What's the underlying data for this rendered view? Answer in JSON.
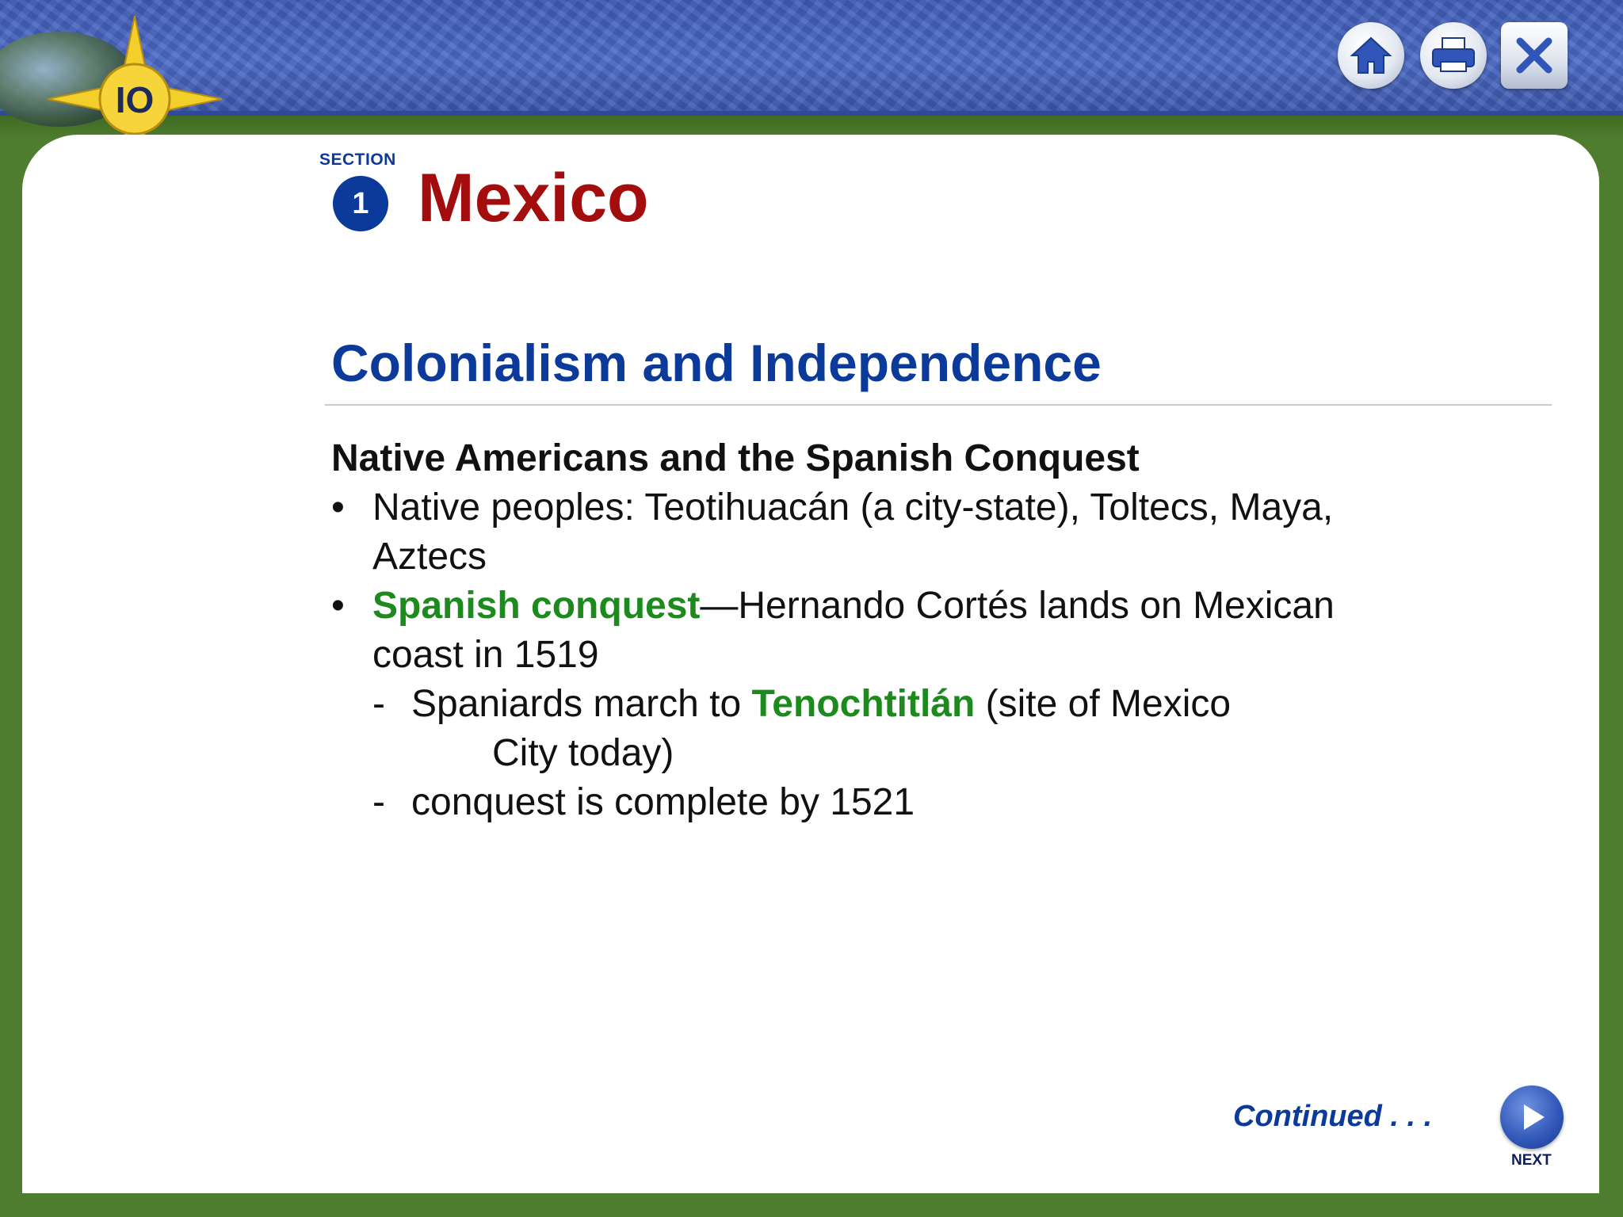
{
  "header": {
    "logo_text": "IO",
    "buttons": [
      {
        "name": "home",
        "icon": "home-icon"
      },
      {
        "name": "print",
        "icon": "printer-icon"
      },
      {
        "name": "close",
        "icon": "close-icon"
      }
    ]
  },
  "section": {
    "label": "SECTION",
    "number": "1"
  },
  "page_title": "Mexico",
  "slide": {
    "heading": "Colonialism and Independence",
    "subheading": "Native Americans and the Spanish Conquest",
    "bullet_1": {
      "mark": "•",
      "text": "Native peoples: Teotihuacán (a city-state), Toltecs, Maya, Aztecs"
    },
    "bullet_2": {
      "mark": "•",
      "term": "Spanish conquest",
      "text": "—Hernando Cortés lands on Mexican coast in 1519"
    },
    "sub_1": {
      "mark": "-",
      "before": "Spaniards march to ",
      "term": "Tenochtitlán",
      "after": " (site of Mexico",
      "continuation": "City today)"
    },
    "sub_2": {
      "mark": "-",
      "text": "conquest is complete by 1521"
    }
  },
  "footer": {
    "continued": "Continued . . .",
    "next_label": "NEXT"
  },
  "colors": {
    "title_red": "#a30d0d",
    "heading_blue": "#0b3a9a",
    "term_green": "#1c8a1c",
    "frame_green": "#4f7d2f"
  }
}
